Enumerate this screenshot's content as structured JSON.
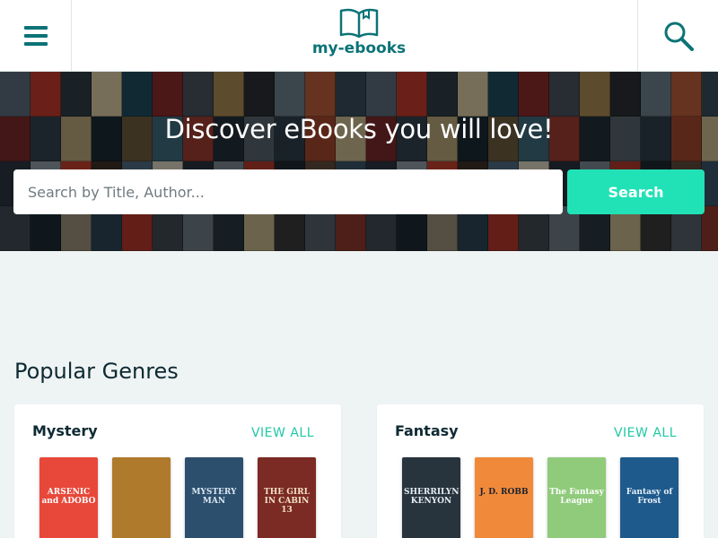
{
  "header": {
    "brand": "my-ebooks",
    "icons": {
      "menu": "hamburger-menu-icon",
      "logo": "open-book-icon",
      "search": "magnifier-icon"
    }
  },
  "hero": {
    "title": "Discover eBooks you will love!",
    "search_placeholder": "Search by Title, Author...",
    "search_value": "",
    "search_button": "Search"
  },
  "popular": {
    "title": "Popular Genres",
    "genres": [
      {
        "name": "Mystery",
        "view_all": "VIEW ALL",
        "books": [
          {
            "title": "ARSENIC and ADOBO",
            "color": "#e8483a",
            "text": "#ffffff"
          },
          {
            "title": "",
            "color": "#b07a2c",
            "text": "#ffffff"
          },
          {
            "title": "MYSTERY MAN",
            "color": "#2d4f6e",
            "text": "#d9e6f2"
          },
          {
            "title": "THE GIRL IN CABIN 13",
            "color": "#7b2a24",
            "text": "#f3e1c8"
          }
        ]
      },
      {
        "name": "Fantasy",
        "view_all": "VIEW ALL",
        "books": [
          {
            "title": "SHERRILYN KENYON",
            "color": "#27343e",
            "text": "#e7edf2"
          },
          {
            "title": "J. D. ROBB",
            "color": "#f08a3a",
            "text": "#1b2230"
          },
          {
            "title": "The Fantasy League",
            "color": "#8fcb7b",
            "text": "#ffffff"
          },
          {
            "title": "Fantasy of Frost",
            "color": "#1f5a8c",
            "text": "#e8f1fb"
          }
        ]
      }
    ]
  },
  "colors": {
    "brand": "#0b7377",
    "accent": "#21e2b7",
    "background": "#eef3f3",
    "header_bg": "#ffffff"
  }
}
